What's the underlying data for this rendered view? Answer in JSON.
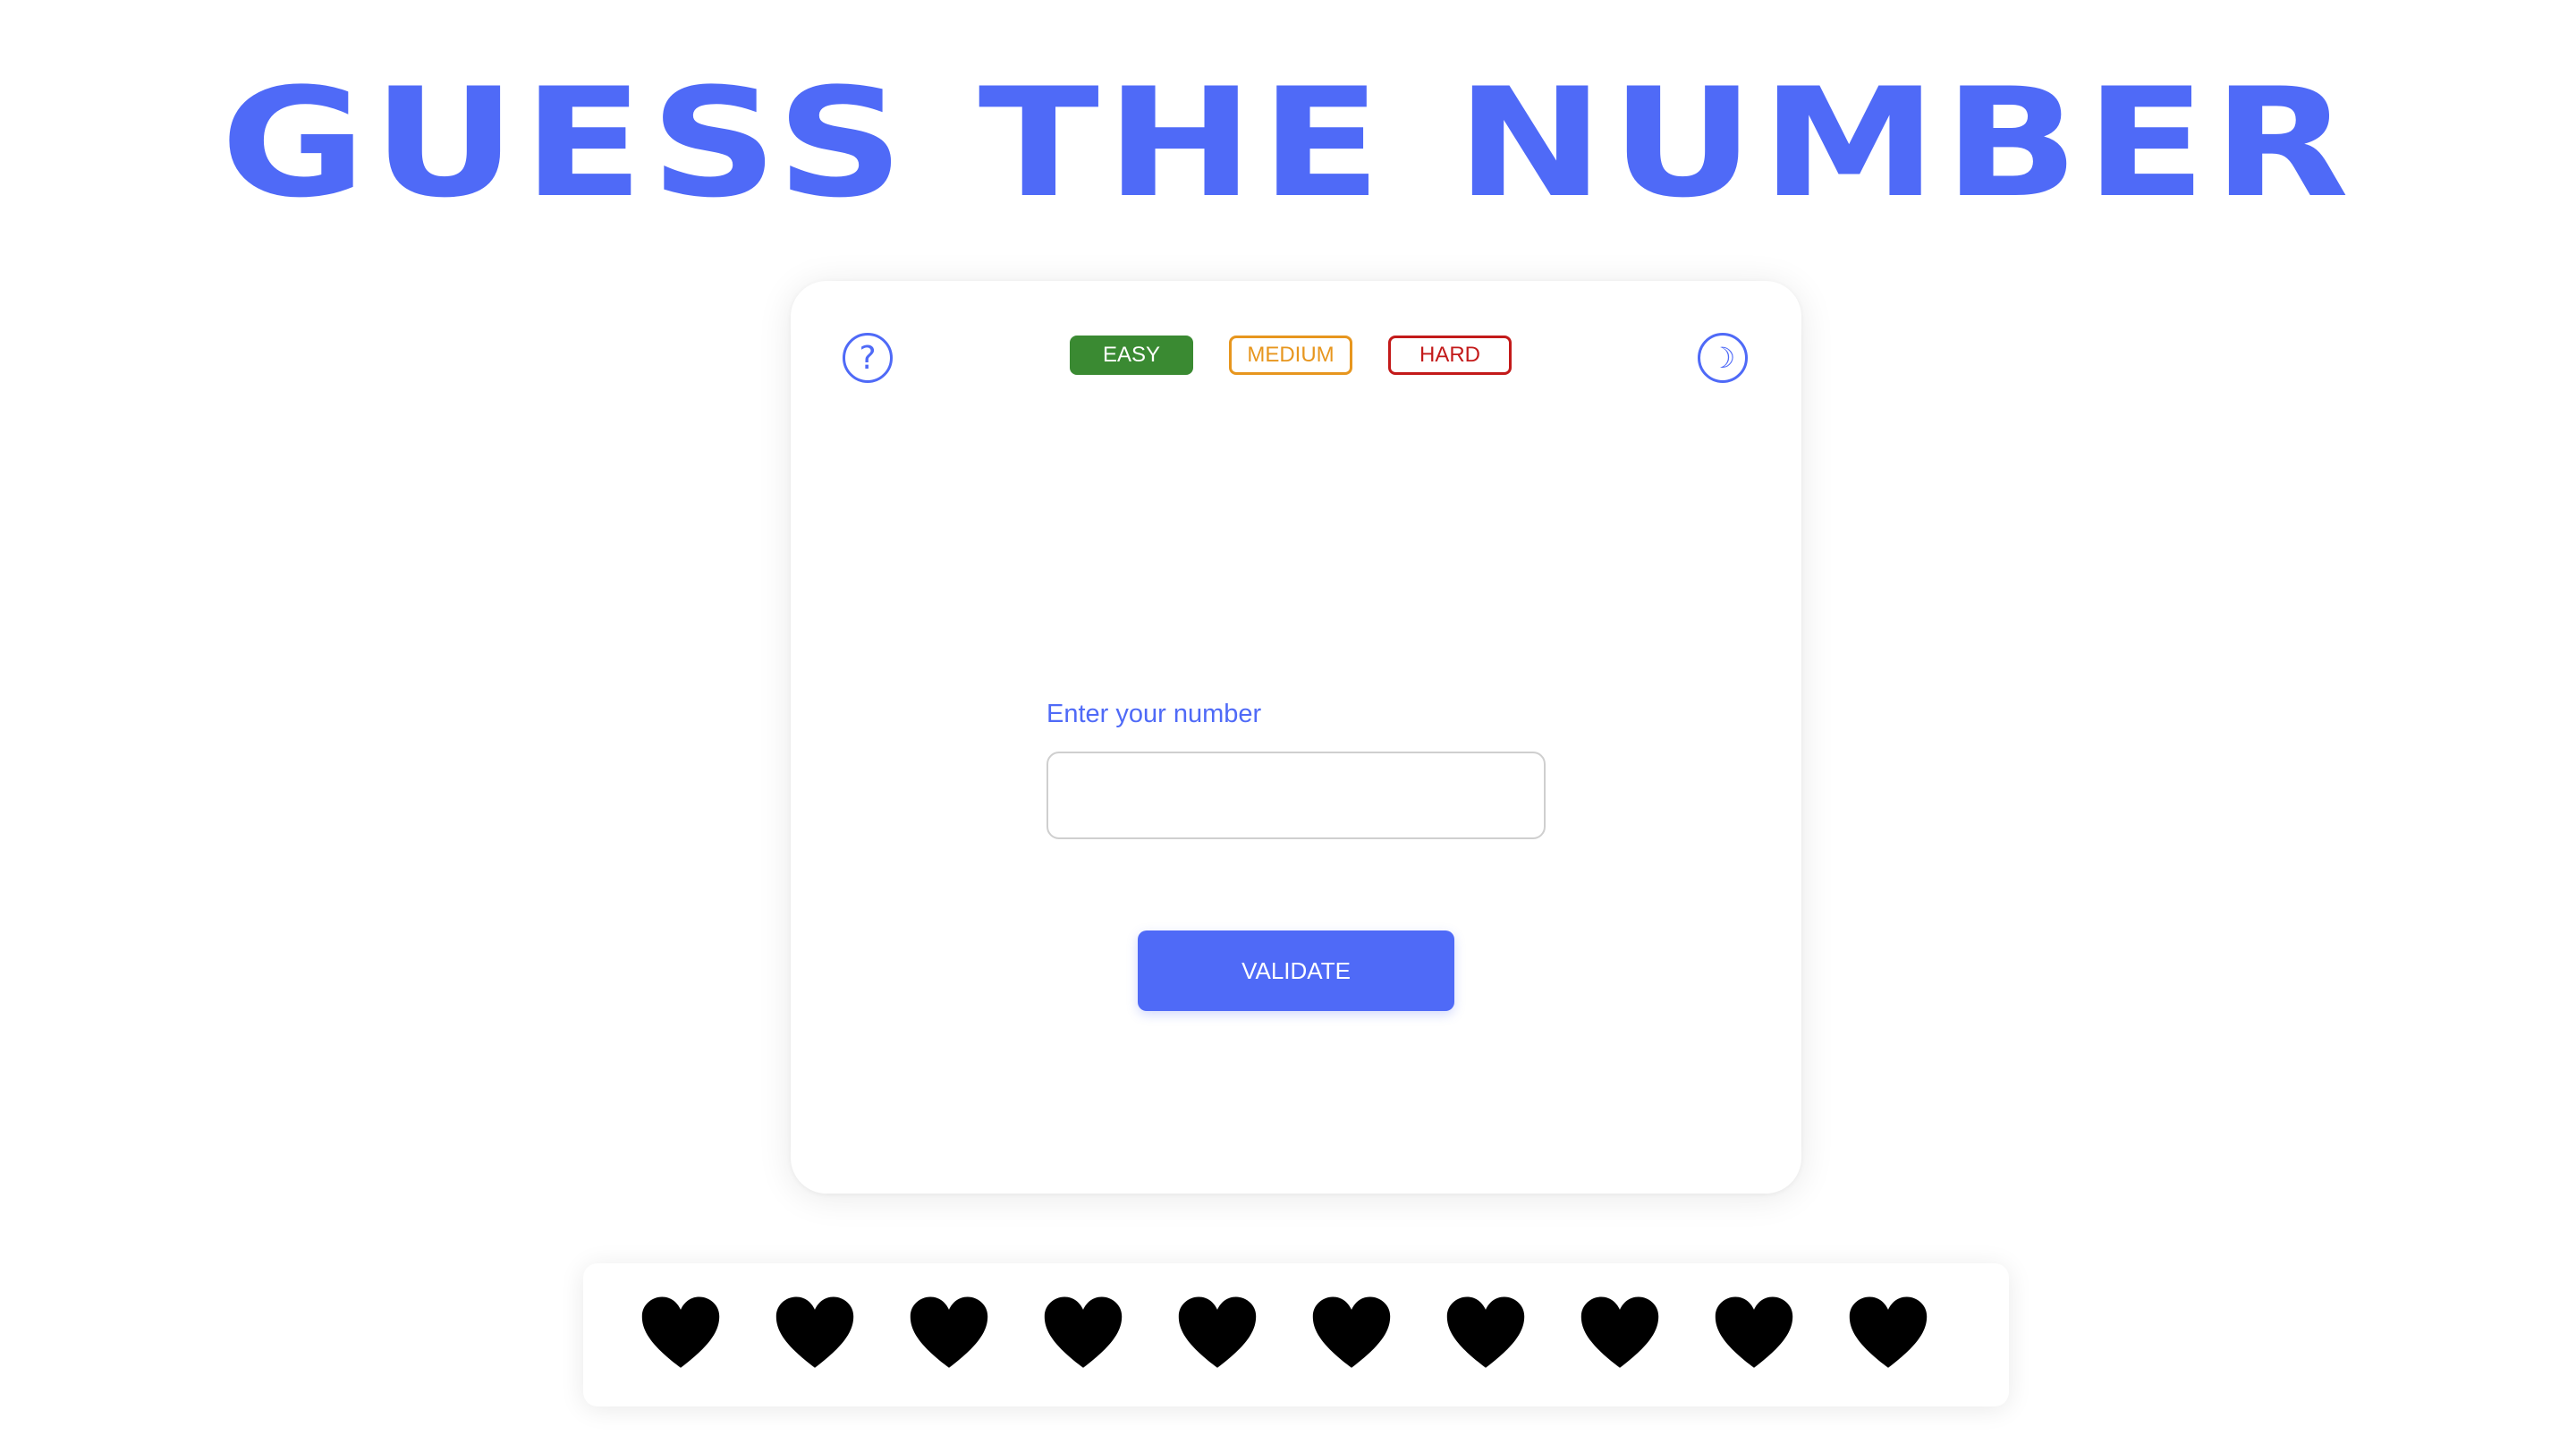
{
  "header": {
    "title": "GUESS THE NUMBER"
  },
  "toolbar": {
    "help_icon": "question-mark-icon",
    "theme_icon": "crescent-moon-icon",
    "help_glyph": "?",
    "theme_glyph": "☽"
  },
  "levels": {
    "easy": "EASY",
    "medium": "MEDIUM",
    "hard": "HARD",
    "selected": "EASY"
  },
  "form": {
    "label": "Enter your number",
    "value": "",
    "placeholder": "",
    "button": "VALIDATE"
  },
  "lives": {
    "count": 10,
    "icon": "heart-icon"
  },
  "colors": {
    "accent": "#4f6af7",
    "easy": "#3a8a32",
    "medium": "#e7961e",
    "hard": "#c31a1a",
    "heart": "#000000"
  }
}
